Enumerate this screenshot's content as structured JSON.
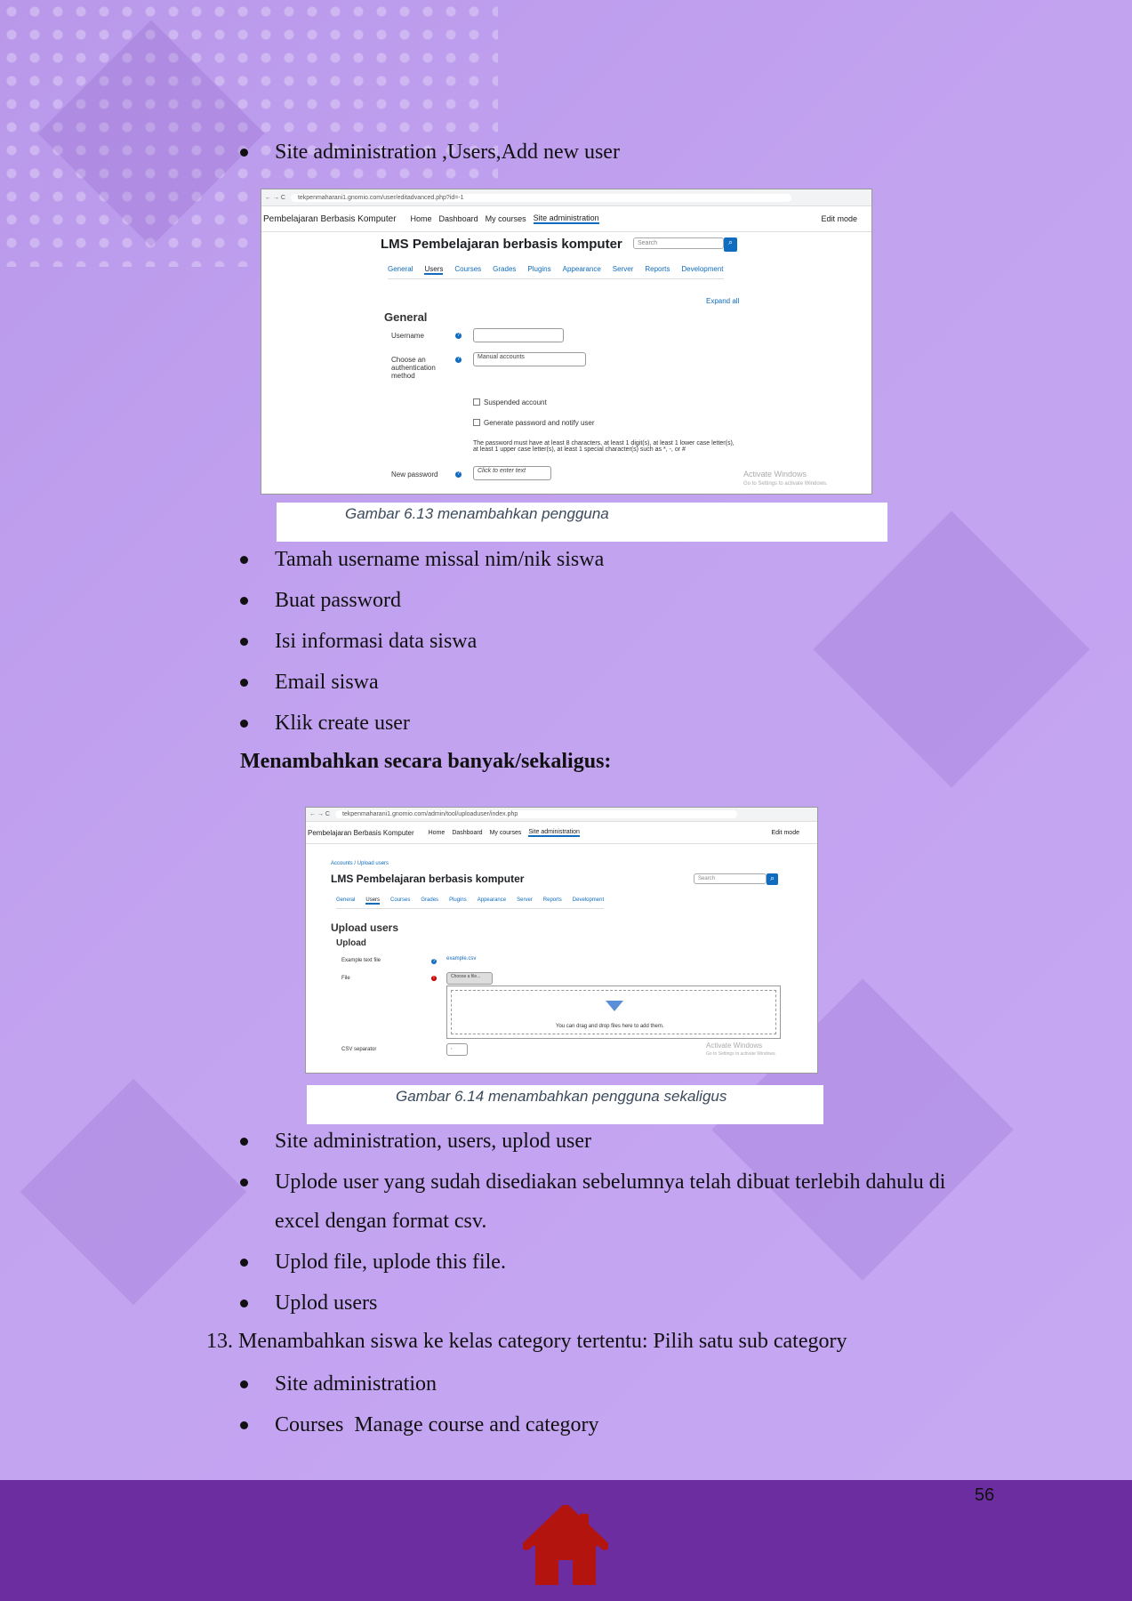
{
  "bullets_top": [
    "Site administration ,Users,Add new user"
  ],
  "screenshot1": {
    "url": "tekpenmaharani1.gnomio.com/user/editadvanced.php?id=-1",
    "brand": "Pembelajaran Berbasis Komputer",
    "nav": [
      "Home",
      "Dashboard",
      "My courses",
      "Site administration"
    ],
    "edit_mode": "Edit mode",
    "title": "LMS Pembelajaran berbasis komputer",
    "search_placeholder": "Search",
    "tabs": [
      "General",
      "Users",
      "Courses",
      "Grades",
      "Plugins",
      "Appearance",
      "Server",
      "Reports",
      "Development"
    ],
    "expand_all": "Expand all",
    "section": "General",
    "username_label": "Username",
    "auth_label": "Choose an authentication method",
    "auth_value": "Manual accounts",
    "suspended": "Suspended account",
    "generate": "Generate password and notify user",
    "password_note": "The password must have at least 8 characters, at least 1 digit(s), at least 1 lower case letter(s), at least 1 upper case letter(s), at least 1 special character(s) such as *, -, or #",
    "new_password_label": "New password",
    "new_password_value": "Click to enter text",
    "watermark_title": "Activate Windows",
    "watermark_sub": "Go to Settings to activate Windows."
  },
  "caption1": "Gambar 6.13 menambahkan pengguna",
  "bullets_mid": [
    "Tamah username missal nim/nik siswa",
    "Buat password",
    "Isi informasi data siswa",
    "Email siswa",
    "Klik create user"
  ],
  "heading": "Menambahkan secara banyak/sekaligus:",
  "screenshot2": {
    "url": "tekpenmaharani1.gnomio.com/admin/tool/uploaduser/index.php",
    "brand": "Pembelajaran Berbasis Komputer",
    "nav": [
      "Home",
      "Dashboard",
      "My courses",
      "Site administration"
    ],
    "edit_mode": "Edit mode",
    "breadcrumb": "Accounts / Upload users",
    "title": "LMS Pembelajaran berbasis komputer",
    "search_placeholder": "Search",
    "tabs": [
      "General",
      "Users",
      "Courses",
      "Grades",
      "Plugins",
      "Appearance",
      "Server",
      "Reports",
      "Development"
    ],
    "page_heading": "Upload users",
    "section": "Upload",
    "example_label": "Example text file",
    "example_link": "example.csv",
    "file_label": "File",
    "choose_file": "Choose a file...",
    "drop_text": "You can drag and drop files here to add them.",
    "csv_label": "CSV separator",
    "csv_value": ",",
    "watermark_title": "Activate Windows",
    "watermark_sub": "Go to Settings to activate Windows."
  },
  "caption2": "Gambar 6.14 menambahkan pengguna sekaligus",
  "bullets_bottom": [
    "Site administration, users, uplod user",
    "Uplode user yang sudah disediakan sebelumnya telah dibuat terlebih dahulu di",
    "excel dengan format csv.",
    "Uplod file, uplode this file.",
    "Uplod users"
  ],
  "numbered_item": "13. Menambahkan siswa ke kelas category tertentu: Pilih satu sub category",
  "bullets_last": [
    "Site administration",
    "Courses  Manage course and category"
  ],
  "page_number": "56",
  "colors": {
    "footer": "#6b2d9f",
    "home_icon": "#b3140e"
  }
}
